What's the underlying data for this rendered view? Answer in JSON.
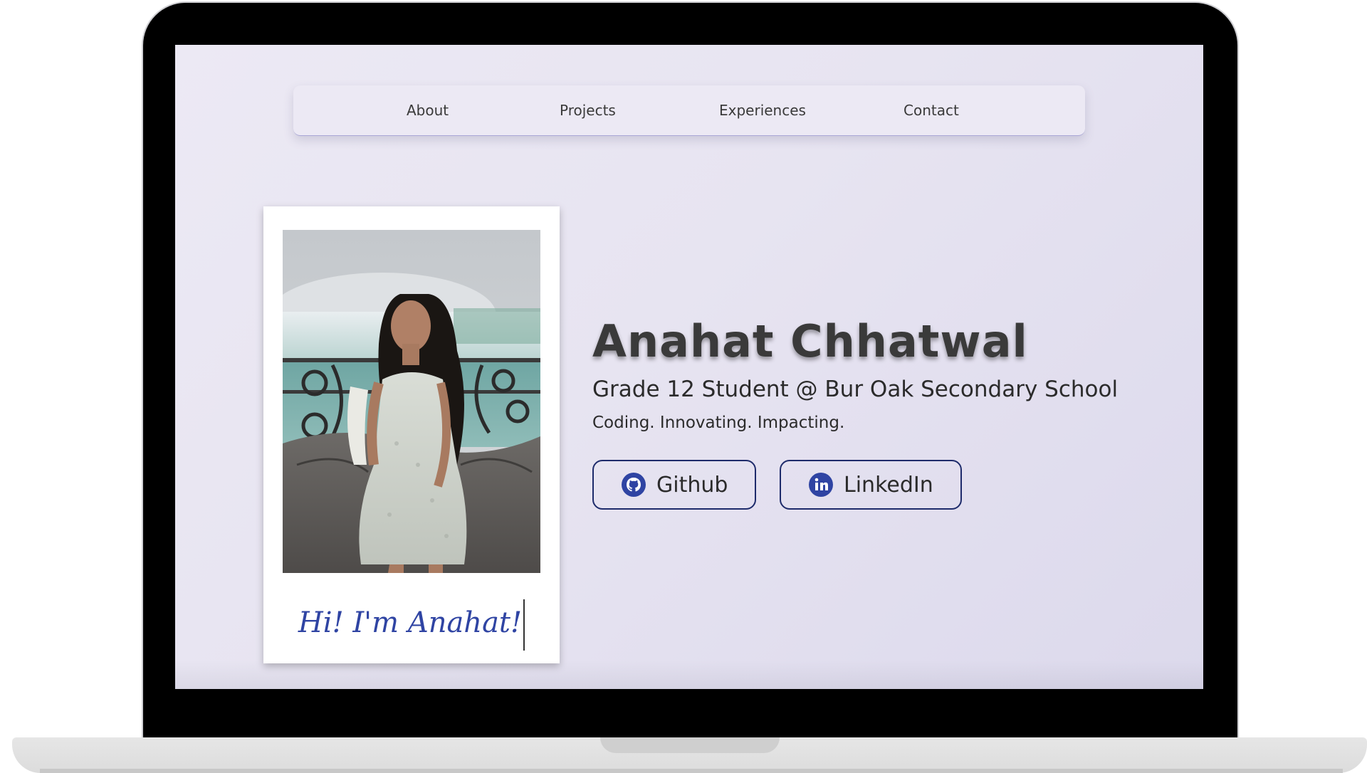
{
  "nav": {
    "items": [
      {
        "label": "About"
      },
      {
        "label": "Projects"
      },
      {
        "label": "Experiences"
      },
      {
        "label": "Contact"
      }
    ]
  },
  "hero": {
    "name": "Anahat Chhatwal",
    "subtitle": "Grade 12 Student @ Bur Oak Secondary School",
    "tagline": "Coding. Innovating. Impacting.",
    "caption": "Hi! I'm Anahat!",
    "buttons": {
      "github": {
        "label": "Github",
        "icon": "github-icon"
      },
      "linkedin": {
        "label": "LinkedIn",
        "icon": "linkedin-icon"
      }
    }
  },
  "colors": {
    "accent": "#2f44a3",
    "button_border": "#1e2b6b",
    "screen_bg": "#e8e5f2"
  }
}
